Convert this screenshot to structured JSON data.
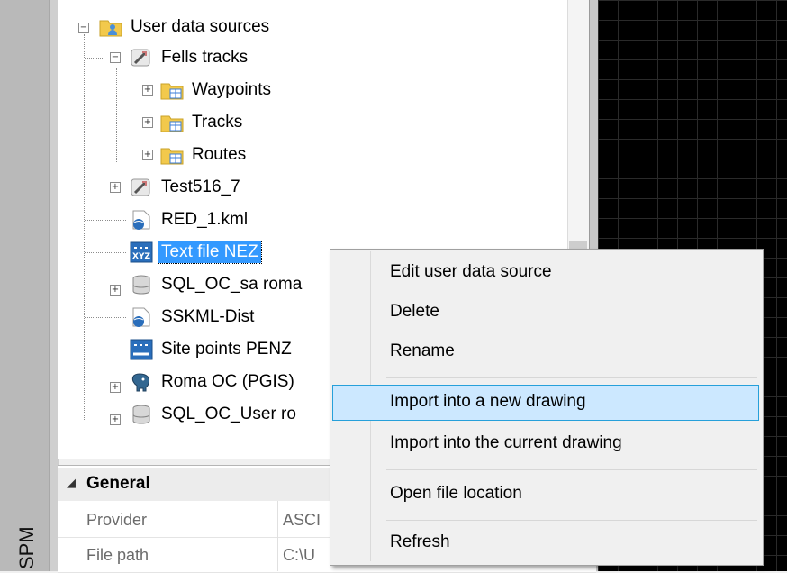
{
  "sidebar": {
    "label": "SPM"
  },
  "tree": {
    "root": {
      "label": "User data sources",
      "expander": "−"
    },
    "items": [
      {
        "label": "Fells tracks",
        "expander": "−"
      },
      {
        "label": "Waypoints",
        "expander": "+"
      },
      {
        "label": "Tracks",
        "expander": "+"
      },
      {
        "label": "Routes",
        "expander": "+"
      },
      {
        "label": "Test516_7",
        "expander": "+"
      },
      {
        "label": "RED_1.kml",
        "expander": ""
      },
      {
        "label": "Text file NEZ",
        "expander": ""
      },
      {
        "label": "SQL_OC_sa roma",
        "expander": "+"
      },
      {
        "label": "SSKML-Dist",
        "expander": ""
      },
      {
        "label": "Site points PENZ",
        "expander": ""
      },
      {
        "label": "Roma OC (PGIS)",
        "expander": "+"
      },
      {
        "label": "SQL_OC_User ro",
        "expander": "+"
      }
    ],
    "selected_icon_text": "XYZ"
  },
  "properties": {
    "section_title": "General",
    "collapse_glyph": "◢",
    "rows": [
      {
        "name": "Provider",
        "value": "ASCI"
      },
      {
        "name": "File path",
        "value": "C:\\U"
      }
    ]
  },
  "context_menu": {
    "items": [
      {
        "label": "Edit user data source"
      },
      {
        "label": "Delete"
      },
      {
        "label": "Rename"
      },
      {
        "label": "Import into a new drawing"
      },
      {
        "label": "Import into the current drawing"
      },
      {
        "label": "Open file location"
      },
      {
        "label": "Refresh"
      }
    ],
    "highlighted_index": 3
  },
  "colors": {
    "selection": "#3399ff",
    "menu_highlight": "#cce8ff",
    "menu_highlight_border": "#26a0da",
    "canvas": "#000000"
  }
}
